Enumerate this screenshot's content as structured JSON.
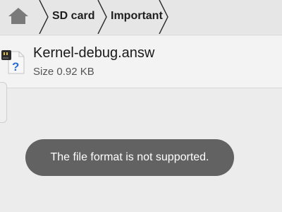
{
  "breadcrumb": {
    "home_icon": "home-icon",
    "items": [
      {
        "label": "SD card"
      },
      {
        "label": "Important"
      }
    ]
  },
  "file": {
    "icon": "unknown-file-type-icon",
    "name": "Kernel-debug.answ",
    "size": "Size 0.92 KB"
  },
  "toast": {
    "message": "The file format is not supported."
  },
  "colors": {
    "toolbar_background": "#e6e6e6",
    "toast_background": "#626262",
    "toast_text": "#ffffff"
  }
}
